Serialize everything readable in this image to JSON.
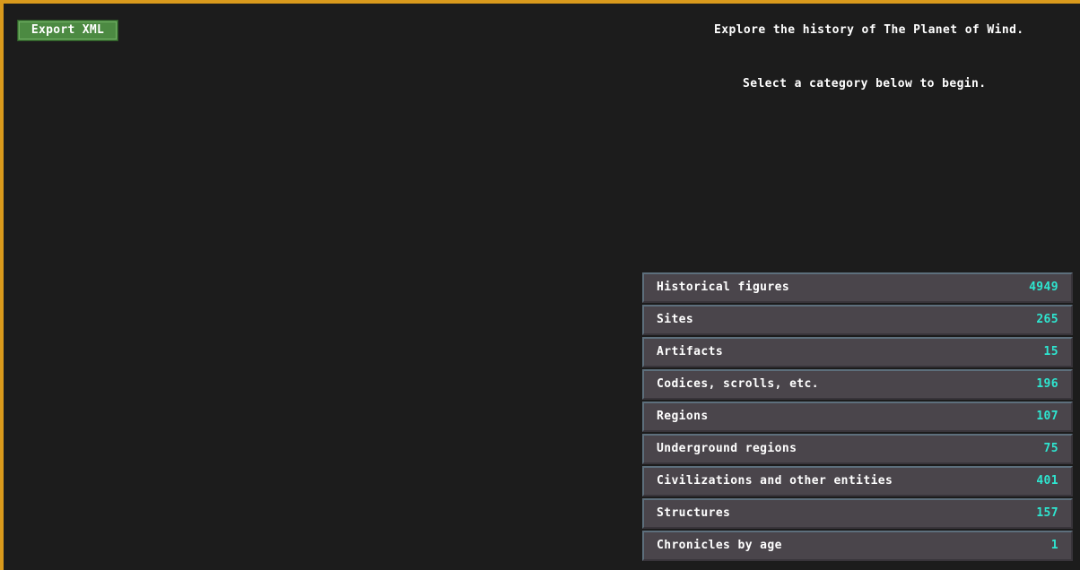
{
  "toolbar": {
    "export_label": "Export XML"
  },
  "intro": {
    "line1": "Explore the history of The Planet of Wind.",
    "line2": "Select a category below to begin."
  },
  "categories": [
    {
      "label": "Historical figures",
      "count": "4949"
    },
    {
      "label": "Sites",
      "count": "265"
    },
    {
      "label": "Artifacts",
      "count": "15"
    },
    {
      "label": "Codices, scrolls, etc.",
      "count": "196"
    },
    {
      "label": "Regions",
      "count": "107"
    },
    {
      "label": "Underground regions",
      "count": "75"
    },
    {
      "label": "Civilizations and other entities",
      "count": "401"
    },
    {
      "label": "Structures",
      "count": "157"
    },
    {
      "label": "Chronicles by age",
      "count": "1"
    }
  ],
  "colors": {
    "frame_border": "#d99a1c",
    "background": "#1c1c1c",
    "export_button": "#4c8a42",
    "row_background": "#4a454b",
    "count_text": "#2ee6d0"
  }
}
